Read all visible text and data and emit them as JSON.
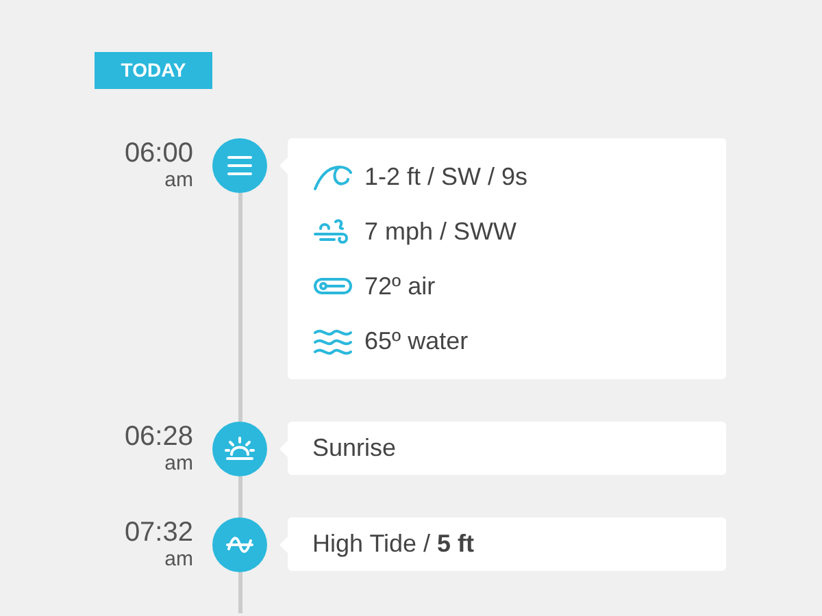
{
  "badge": "TODAY",
  "events": [
    {
      "kind": "conditions",
      "time": "06:00",
      "period": "am",
      "details": [
        {
          "kind": "wave",
          "text": "1-2 ft / SW / 9s"
        },
        {
          "kind": "wind",
          "text": "7 mph / SWW"
        },
        {
          "kind": "thermometer",
          "text": "72º air"
        },
        {
          "kind": "water",
          "text": "65º water"
        }
      ]
    },
    {
      "kind": "sunrise",
      "time": "06:28",
      "period": "am",
      "text": "Sunrise"
    },
    {
      "kind": "tide",
      "time": "07:32",
      "period": "am",
      "text": "High Tide / **5 ft**"
    }
  ]
}
